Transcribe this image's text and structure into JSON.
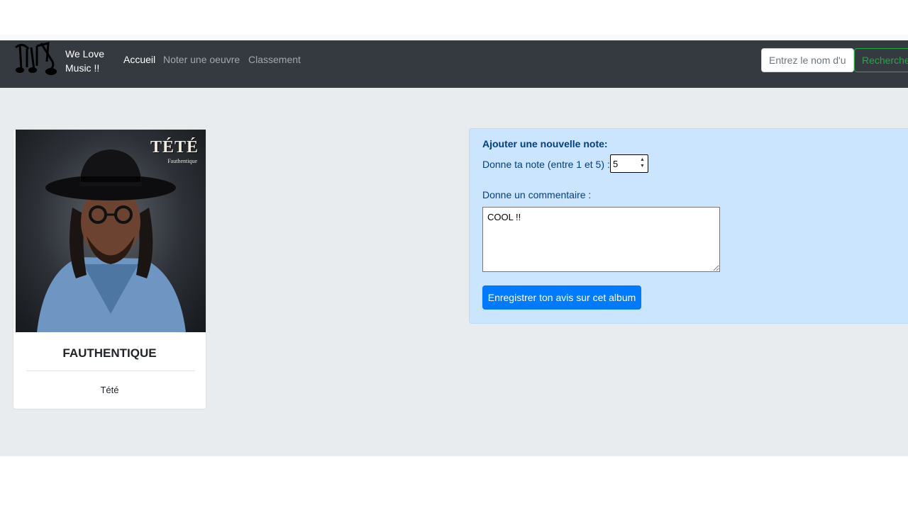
{
  "brand": {
    "line1": "We Love",
    "line2": "Music !!"
  },
  "nav": {
    "items": [
      {
        "label": "Accueil"
      },
      {
        "label": "Noter une oeuvre"
      },
      {
        "label": "Classement"
      }
    ]
  },
  "search": {
    "placeholder": "Entrez le nom d'un",
    "button_label": "Rechercher"
  },
  "album": {
    "title": "FAUTHENTIQUE",
    "artist": "Tété",
    "cover_title": "TÉTÉ",
    "cover_subtitle": "Fauthentique"
  },
  "form": {
    "heading": "Ajouter une nouvelle note:",
    "rating_label": "Donne ta note (entre 1 et 5) :",
    "rating_value": "5",
    "comment_label": "Donne un commentaire :",
    "comment_value": "COOL !!",
    "submit_label": "Enregistrer ton avis sur cet album"
  },
  "colors": {
    "navbar": "#343a40",
    "accent": "#007bff",
    "success": "#28a745",
    "alert_bg": "#cce5ff"
  }
}
